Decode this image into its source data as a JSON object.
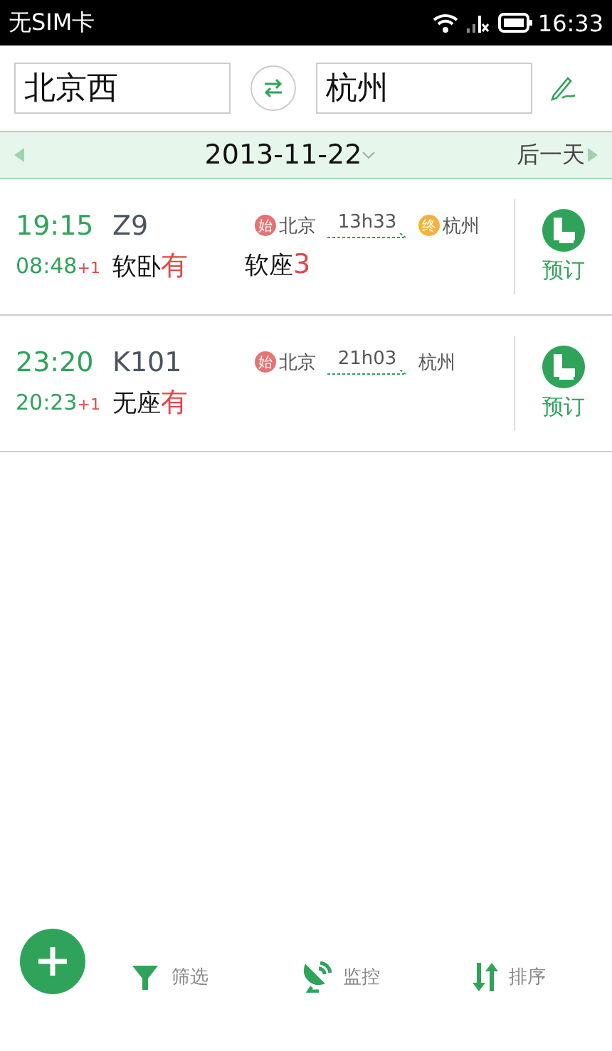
{
  "status_bar": {
    "carrier": "无SIM卡",
    "time": "16:33"
  },
  "search": {
    "from": "北京西",
    "to": "杭州"
  },
  "date_bar": {
    "date": "2013-11-22",
    "next": "后一天"
  },
  "trains": [
    {
      "depart": "19:15",
      "arrive": "08:48",
      "day_offset": "+1",
      "number": "Z9",
      "from": {
        "name": "北京",
        "badge": {
          "text": "始",
          "color": "#e57373"
        }
      },
      "duration": "13h33",
      "to": {
        "name": "杭州",
        "badge": {
          "text": "终",
          "color": "#f5b13c"
        }
      },
      "seats": [
        {
          "type": "软卧",
          "count": "有"
        },
        {
          "type": "软座",
          "count": "3"
        }
      ],
      "action": "预订"
    },
    {
      "depart": "23:20",
      "arrive": "20:23",
      "day_offset": "+1",
      "number": "K101",
      "from": {
        "name": "北京",
        "badge": {
          "text": "始",
          "color": "#e57373"
        }
      },
      "duration": "21h03",
      "to": {
        "name": "杭州"
      },
      "seats": [
        {
          "type": "无座",
          "count": "有"
        }
      ],
      "action": "预订"
    }
  ],
  "toolbar": [
    {
      "kind": "filter",
      "label": "筛选"
    },
    {
      "kind": "monitor",
      "label": "监控"
    },
    {
      "kind": "sort",
      "label": "排序"
    }
  ]
}
